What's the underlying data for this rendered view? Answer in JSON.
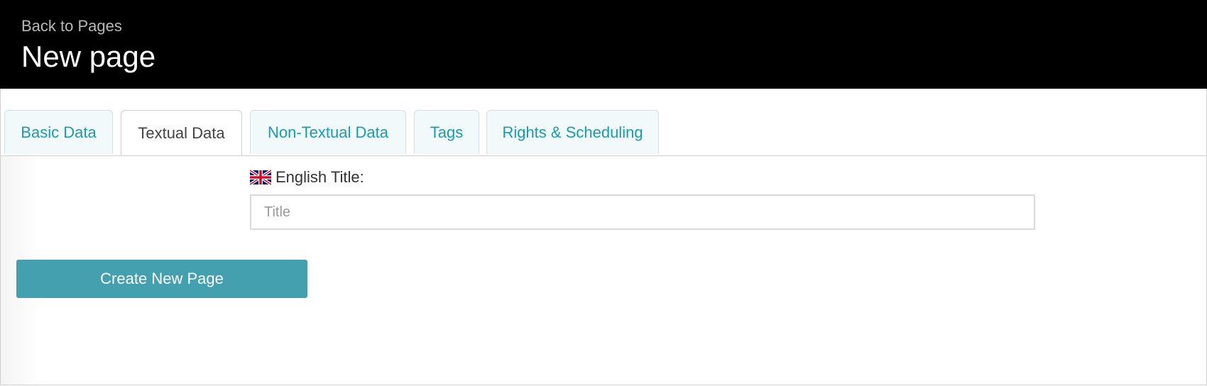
{
  "header": {
    "back_link": "Back to Pages",
    "title": "New page"
  },
  "tabs": [
    {
      "label": "Basic Data",
      "active": false
    },
    {
      "label": "Textual Data",
      "active": true
    },
    {
      "label": "Non-Textual Data",
      "active": false
    },
    {
      "label": "Tags",
      "active": false
    },
    {
      "label": "Rights & Scheduling",
      "active": false
    }
  ],
  "form": {
    "flag_icon": "uk-flag-icon",
    "title_label": "English Title:",
    "title_value": "",
    "title_placeholder": "Title"
  },
  "actions": {
    "create_label": "Create New Page"
  },
  "colors": {
    "header_bg": "#000000",
    "tab_text": "#189cb0",
    "button_bg": "#449fae"
  }
}
